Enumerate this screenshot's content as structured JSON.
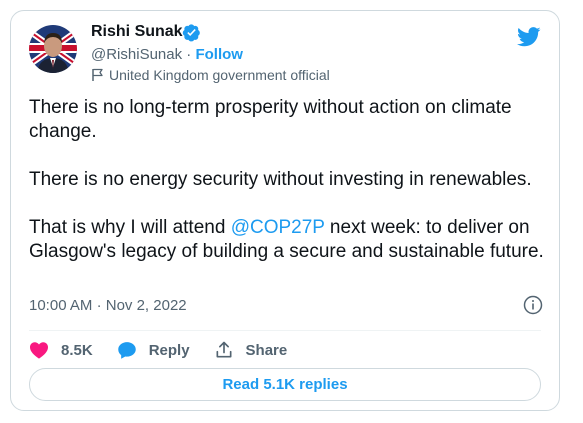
{
  "author": {
    "name": "Rishi Sunak",
    "handle": "@RishiSunak",
    "separator": "·",
    "follow_label": "Follow",
    "label": "United Kingdom government official"
  },
  "tweet": {
    "paragraphs": [
      {
        "before": "There is no long-term prosperity without action on climate change.",
        "mention": "",
        "after": ""
      },
      {
        "before": "There is no energy security without investing in renewables.",
        "mention": "",
        "after": ""
      },
      {
        "before": "That is why I will attend ",
        "mention": "@COP27P",
        "after": " next week: to deliver on Glasgow's legacy of building a secure and sustainable future."
      }
    ],
    "time": "10:00 AM",
    "date_separator": "·",
    "date": "Nov 2, 2022"
  },
  "actions": {
    "likes": "8.5K",
    "reply_label": "Reply",
    "share_label": "Share"
  },
  "read_replies_label": "Read 5.1K replies",
  "icons": [
    "avatar",
    "verified-badge-icon",
    "twitter-bird-icon",
    "flag-icon",
    "info-icon",
    "heart-icon",
    "reply-bubble-icon",
    "share-icon"
  ],
  "colors": {
    "accent": "#1d9bf0",
    "like": "#f91880",
    "muted": "#536471",
    "text": "#0f1419",
    "border": "#cfd9de"
  }
}
